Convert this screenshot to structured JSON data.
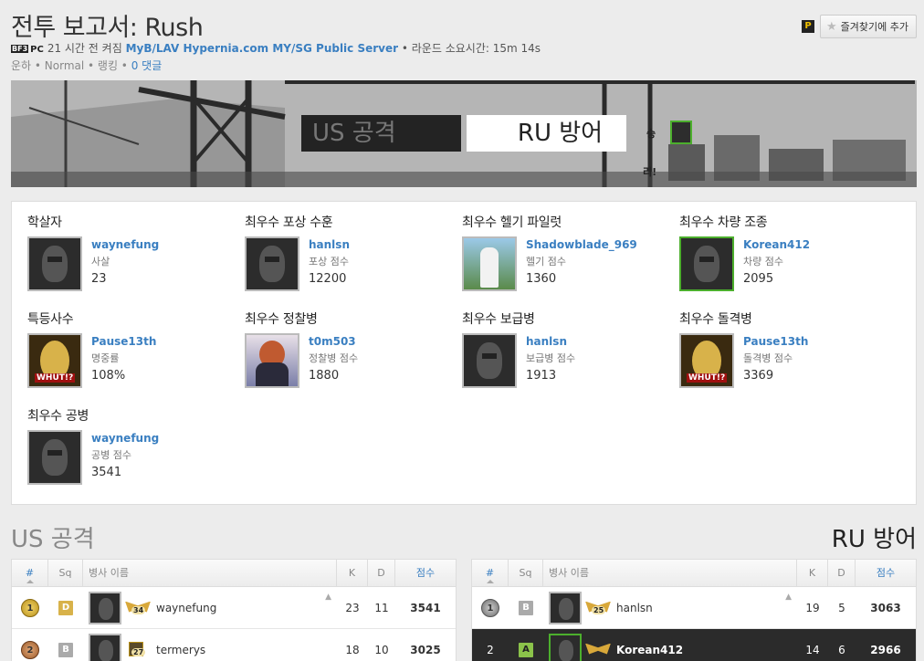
{
  "header": {
    "title": "전투 보고서: Rush",
    "bf_badge": "BF3",
    "platform": "PC",
    "time_ago": "21 시간 전",
    "conquered_text": "켜짐",
    "server": "MyB/LAV Hypernia.com MY/SG Public Server",
    "round_time": "• 라운드 소요시간: 15m 14s",
    "mode": "운하 • Normal • 랭킹 •",
    "comments": "0 댓글",
    "favorite_button": "즐겨찾기에 추가",
    "p_icon": "P"
  },
  "banner": {
    "team_us": "US 공격",
    "team_ru": "RU 방어",
    "win_label_top": "승",
    "win_label_bottom": "리!"
  },
  "awards": [
    {
      "title": "학살자",
      "player": "waynefung",
      "stat": "사살",
      "value": "23",
      "avatar": "mask"
    },
    {
      "title": "최우수 포상 수훈",
      "player": "hanlsn",
      "stat": "포상 점수",
      "value": "12200",
      "avatar": "mask"
    },
    {
      "title": "최우수 헬기 파일럿",
      "player": "Shadowblade_969",
      "stat": "헬기 점수",
      "value": "1360",
      "avatar": "photo"
    },
    {
      "title": "최우수 차량 조종",
      "player": "Korean412",
      "stat": "차량 점수",
      "value": "2095",
      "avatar": "mask-green"
    },
    {
      "title": "특등사수",
      "player": "Pause13th",
      "stat": "명중률",
      "value": "108%",
      "avatar": "mona"
    },
    {
      "title": "최우수 정찰병",
      "player": "t0m503",
      "stat": "정찰병 점수",
      "value": "1880",
      "avatar": "anime"
    },
    {
      "title": "최우수 보급병",
      "player": "hanlsn",
      "stat": "보급병 점수",
      "value": "1913",
      "avatar": "mask"
    },
    {
      "title": "최우수 돌격병",
      "player": "Pause13th",
      "stat": "돌격병 점수",
      "value": "3369",
      "avatar": "mona"
    },
    {
      "title": "최우수 공병",
      "player": "waynefung",
      "stat": "공병 점수",
      "value": "3541",
      "avatar": "mask"
    }
  ],
  "teams": {
    "us_title": "US 공격",
    "ru_title": "RU 방어"
  },
  "table_headers": {
    "rank": "#",
    "squad": "Sq",
    "name": "병사 이름",
    "kills": "K",
    "deaths": "D",
    "score": "점수"
  },
  "us_rows": [
    {
      "rank": "1",
      "squad": "D",
      "rank_num": "34",
      "name": "waynefung",
      "kills": "23",
      "deaths": "11",
      "score": "3541",
      "warn": "▲"
    },
    {
      "rank": "2",
      "squad": "B",
      "rank_num": "27",
      "name": "termerys",
      "kills": "18",
      "deaths": "10",
      "score": "3025",
      "warn": ""
    }
  ],
  "ru_rows": [
    {
      "rank": "1",
      "squad": "B",
      "rank_num": "25",
      "name": "hanlsn",
      "kills": "19",
      "deaths": "5",
      "score": "3063",
      "warn": "▲"
    },
    {
      "rank": "2",
      "squad": "A",
      "rank_num": "",
      "name": "Korean412",
      "kills": "14",
      "deaths": "6",
      "score": "2966",
      "warn": ""
    }
  ],
  "colors": {
    "link": "#3a7fc1",
    "accent_green": "#4caf2d",
    "dark_row": "#2b2b2b"
  }
}
